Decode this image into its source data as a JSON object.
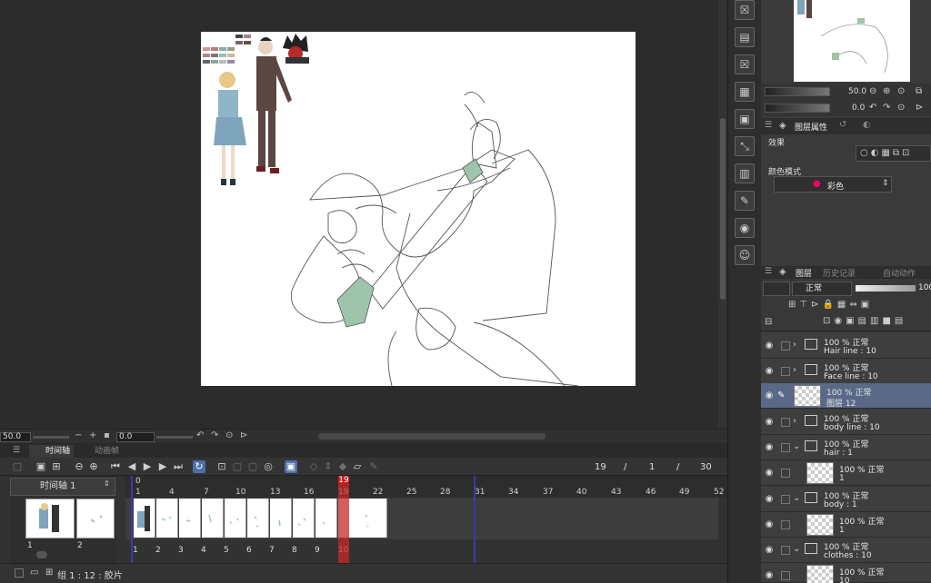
{
  "zoombar": {
    "zoom": "50.0",
    "rotation": "0.0"
  },
  "timeline": {
    "tab_timeline": "时间轴",
    "tab_animation_cels": "动画帧",
    "timeline_name": "时间轴 1",
    "current_frame": "19",
    "start_frame": "1",
    "end_frame": "30",
    "slash": "/",
    "playhead_label": "19",
    "ruler_numbers": [
      "0",
      "1",
      "4",
      "7",
      "10",
      "13",
      "16",
      "19",
      "22",
      "25",
      "28",
      "31",
      "34",
      "37",
      "40",
      "43",
      "46",
      "49",
      "52"
    ],
    "cel_numbers": [
      "1",
      "2",
      "3",
      "4",
      "5",
      "6",
      "7",
      "8",
      "9",
      "10"
    ],
    "left_thumbs": [
      "1",
      "2"
    ],
    "track_label": "组 1 : 12 : 胶片"
  },
  "navigator": {
    "zoom": "50.0",
    "rotation": "0.0"
  },
  "properties": {
    "tab_layer_props": "图层属性",
    "effect_label": "效果",
    "color_mode_label": "颜色模式",
    "color_mode_value": "彩色"
  },
  "layers_panel": {
    "tab_layers": "图层",
    "tab_history": "历史记录",
    "tab_auto_actions": "自动动作",
    "blend_mode": "正常",
    "opacity": "100",
    "layers": [
      {
        "opacity": "100 %",
        "mode": "正常",
        "name": "Hair line : 10"
      },
      {
        "opacity": "100 %",
        "mode": "正常",
        "name": "Face line : 10"
      },
      {
        "opacity": "100 %",
        "mode": "正常",
        "name": "图层 12"
      },
      {
        "opacity": "100 %",
        "mode": "正常",
        "name": "body line : 10"
      },
      {
        "opacity": "100 %",
        "mode": "正常",
        "name": "hair : 1"
      },
      {
        "opacity": "100 %",
        "mode": "正常",
        "name": "1"
      },
      {
        "opacity": "100 %",
        "mode": "正常",
        "name": "body : 1"
      },
      {
        "opacity": "100 %",
        "mode": "正常",
        "name": "1"
      },
      {
        "opacity": "100 %",
        "mode": "正常",
        "name": "clothes : 10"
      },
      {
        "opacity": "100 %",
        "mode": "正常",
        "name": "10"
      }
    ]
  },
  "colors": {
    "accent": "#4b6ea8",
    "playhead": "#c41c1c",
    "selected_layer": "#596987",
    "sleeve": "#9fc4ac"
  }
}
